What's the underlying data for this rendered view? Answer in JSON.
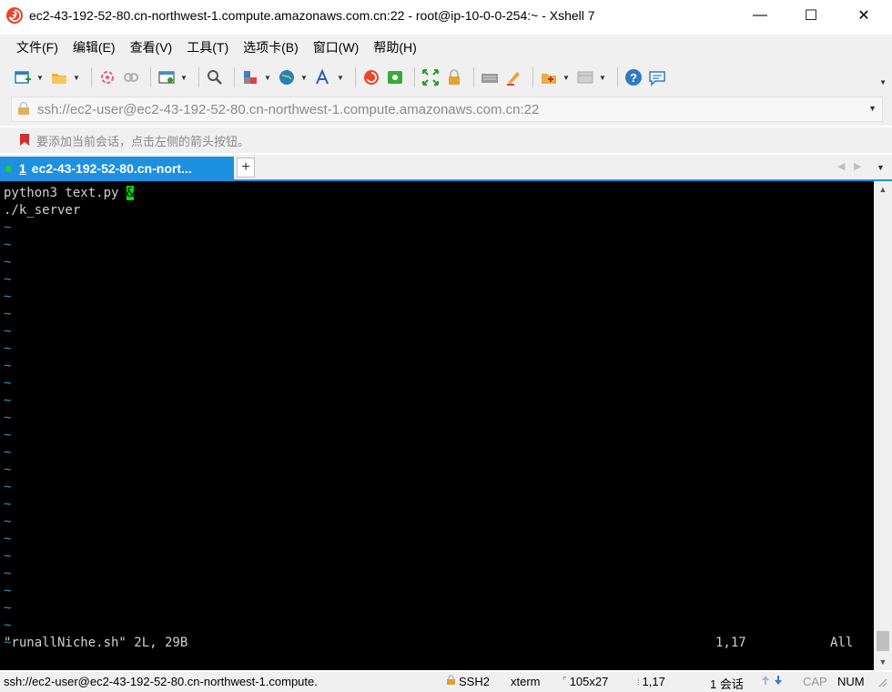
{
  "window": {
    "title": "ec2-43-192-52-80.cn-northwest-1.compute.amazonaws.com.cn:22 - root@ip-10-0-0-254:~ - Xshell 7",
    "icon": "xshell-logo-icon",
    "controls": {
      "minimize": "—",
      "maximize": "☐",
      "close": "✕"
    }
  },
  "menu": {
    "items": [
      "文件(F)",
      "编辑(E)",
      "查看(V)",
      "工具(T)",
      "选项卡(B)",
      "窗口(W)",
      "帮助(H)"
    ]
  },
  "toolbar": {
    "icons": [
      "new-session-icon",
      "open-folder-icon",
      "reconnect-icon",
      "disconnect-icon",
      "new-window-icon",
      "find-icon",
      "properties-icon",
      "globe-icon",
      "font-icon",
      "xshell-icon",
      "xftp-icon",
      "fullscreen-icon",
      "lock-icon",
      "keyboard-icon",
      "highlight-icon",
      "compose-icon",
      "layout-icon",
      "help-icon",
      "chat-icon"
    ]
  },
  "address": {
    "value": "ssh://ec2-user@ec2-43-192-52-80.cn-northwest-1.compute.amazonaws.com.cn:22"
  },
  "hint": {
    "text": "要添加当前会话，点击左侧的箭头按钮。"
  },
  "tabs": [
    {
      "number": "1",
      "label": "ec2-43-192-52-80.cn-nort...",
      "active": true
    }
  ],
  "tabbar": {
    "add_label": "+",
    "prev": "◀",
    "next": "▶",
    "menu": "▼"
  },
  "terminal": {
    "lines": [
      "python3 text.py ",
      "./k_server"
    ],
    "cursor_char": "&",
    "tilde_char": "~",
    "tilde_count": 25,
    "status_file": "\"runallNiche.sh\" 2L, 29B",
    "status_pos": "1,17",
    "status_scroll": "All"
  },
  "statusbar": {
    "connection": "ssh://ec2-user@ec2-43-192-52-80.cn-northwest-1.compute.",
    "protocol": "SSH2",
    "terminal_type": "xterm",
    "size": "105x27",
    "cursor": "1,17",
    "sessions": "1 会话",
    "cap": "CAP",
    "num": "NUM"
  },
  "colors": {
    "tab_active": "#1e90e0",
    "cursor": "#00e000",
    "tilde": "#3a8fc8",
    "terminal_bg": "#000000"
  }
}
